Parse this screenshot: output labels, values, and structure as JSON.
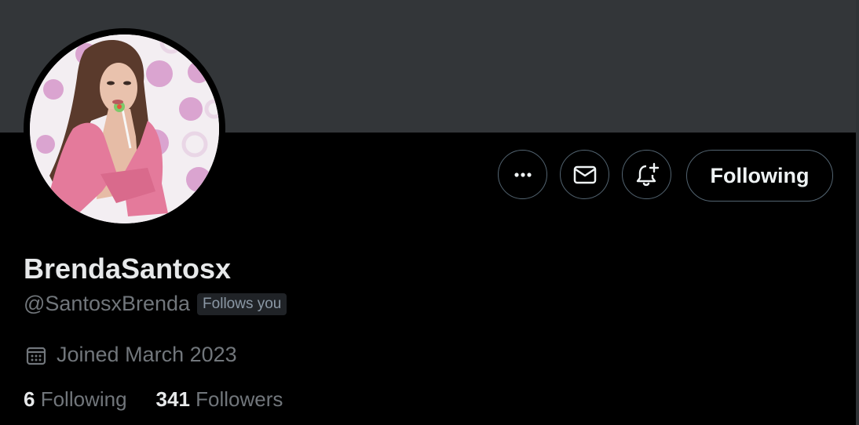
{
  "profile": {
    "display_name": "BrendaSantosx",
    "handle": "@SantosxBrenda",
    "follows_you_badge": "Follows you",
    "joined": "Joined March 2023",
    "following_count": "6",
    "following_label": "Following",
    "followers_count": "341",
    "followers_label": "Followers"
  },
  "actions": {
    "more_icon": "more-horizontal-icon",
    "message_icon": "envelope-icon",
    "notify_icon": "bell-plus-icon",
    "following_button_label": "Following"
  },
  "colors": {
    "banner": "#333639",
    "background": "#000000",
    "text_primary": "#e7e9ea",
    "text_secondary": "#71767b",
    "button_border": "#536471",
    "badge_background": "#202327"
  }
}
